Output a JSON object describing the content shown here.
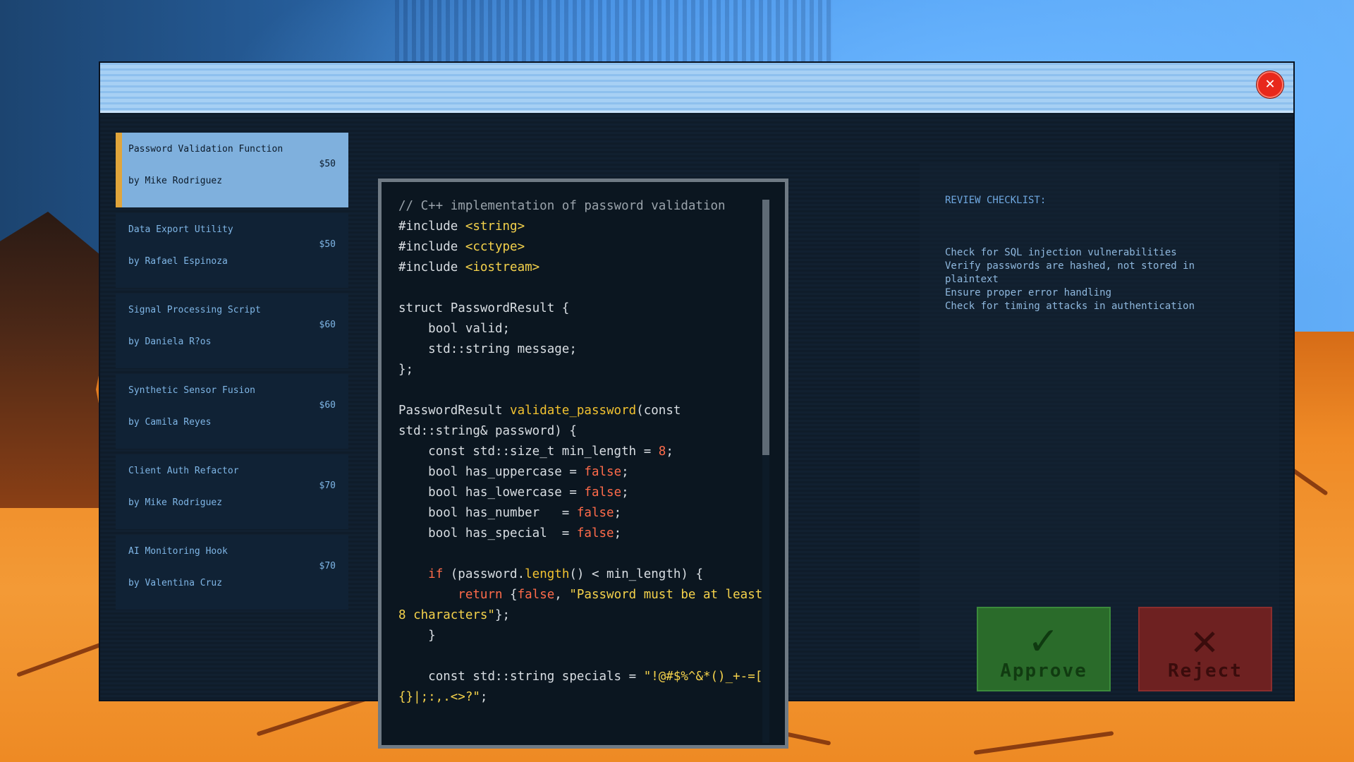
{
  "window": {
    "close_icon": "close-x-icon"
  },
  "tasks": [
    {
      "title": "Password Validation Function",
      "author": "by Mike Rodriguez",
      "price": "$50",
      "active": true
    },
    {
      "title": "Data Export Utility",
      "author": "by Rafael Espinoza",
      "price": "$50",
      "active": false
    },
    {
      "title": "Signal Processing Script",
      "author": "by Daniela R?os",
      "price": "$60",
      "active": false
    },
    {
      "title": "Synthetic Sensor Fusion",
      "author": "by Camila Reyes",
      "price": "$60",
      "active": false
    },
    {
      "title": "Client Auth Refactor",
      "author": "by Mike Rodriguez",
      "price": "$70",
      "active": false
    },
    {
      "title": "AI Monitoring Hook",
      "author": "by Valentina Cruz",
      "price": "$70",
      "active": false
    }
  ],
  "code_lines": [
    [
      [
        "c",
        "// C++ implementation of password validation"
      ]
    ],
    [
      [
        "t",
        "#include "
      ],
      [
        "s",
        "<string>"
      ]
    ],
    [
      [
        "t",
        "#include "
      ],
      [
        "s",
        "<cctype>"
      ]
    ],
    [
      [
        "t",
        "#include "
      ],
      [
        "s",
        "<iostream>"
      ]
    ],
    [],
    [
      [
        "t",
        "struct PasswordResult {"
      ]
    ],
    [
      [
        "t",
        "    bool valid;"
      ]
    ],
    [
      [
        "t",
        "    std::string message;"
      ]
    ],
    [
      [
        "t",
        "};"
      ]
    ],
    [],
    [
      [
        "t",
        "PasswordResult "
      ],
      [
        "f",
        "validate_password"
      ],
      [
        "t",
        "(const std::string& password) {"
      ]
    ],
    [
      [
        "t",
        "    const std::size_t min_length = "
      ],
      [
        "k",
        "8"
      ],
      [
        "t",
        ";"
      ]
    ],
    [
      [
        "t",
        "    bool has_uppercase = "
      ],
      [
        "k",
        "false"
      ],
      [
        "t",
        ";"
      ]
    ],
    [
      [
        "t",
        "    bool has_lowercase = "
      ],
      [
        "k",
        "false"
      ],
      [
        "t",
        ";"
      ]
    ],
    [
      [
        "t",
        "    bool has_number   = "
      ],
      [
        "k",
        "false"
      ],
      [
        "t",
        ";"
      ]
    ],
    [
      [
        "t",
        "    bool has_special  = "
      ],
      [
        "k",
        "false"
      ],
      [
        "t",
        ";"
      ]
    ],
    [],
    [
      [
        "t",
        "    "
      ],
      [
        "k",
        "if"
      ],
      [
        "t",
        " (password."
      ],
      [
        "f",
        "length"
      ],
      [
        "t",
        "() < min_length) {"
      ]
    ],
    [
      [
        "t",
        "        "
      ],
      [
        "k",
        "return"
      ],
      [
        "t",
        " {"
      ],
      [
        "k",
        "false"
      ],
      [
        "t",
        ", "
      ],
      [
        "s",
        "\"Password must be at least 8 characters\""
      ],
      [
        "t",
        "};"
      ]
    ],
    [
      [
        "t",
        "    }"
      ]
    ],
    [],
    [
      [
        "t",
        "    const std::string specials = "
      ],
      [
        "s",
        "\"!@#$%^&*()_+-=[]{}|;:,.<>?\""
      ],
      [
        "t",
        ";"
      ]
    ]
  ],
  "checklist": {
    "heading": "REVIEW CHECKLIST:",
    "items": [
      "Check for SQL injection vulnerabilities",
      "Verify passwords are hashed, not stored in plaintext",
      "Ensure proper error handling",
      "Check for timing attacks in authentication"
    ]
  },
  "buttons": {
    "approve_label": "Approve",
    "reject_label": "Reject",
    "approve_icon": "checkmark-icon",
    "reject_icon": "x-mark-icon"
  },
  "colors": {
    "active_accent": "#e0a53b",
    "approve": "#2a6b2a",
    "reject": "#6e2121"
  }
}
